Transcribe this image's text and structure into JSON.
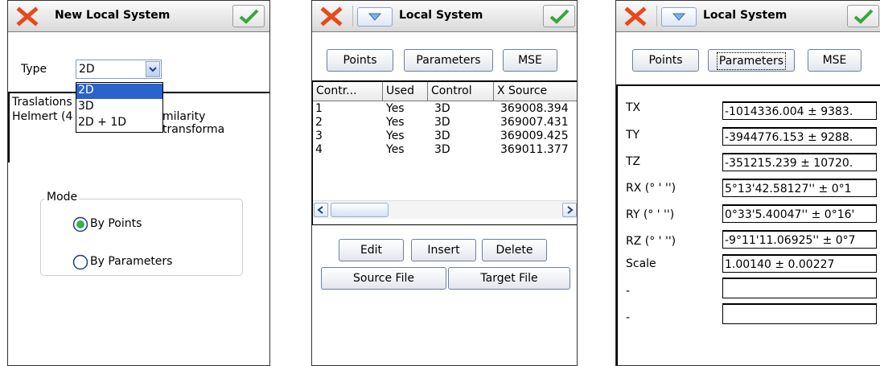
{
  "panel1": {
    "title": "New Local System",
    "type_label": "Type",
    "type_value": "2D",
    "type_options": [
      "2D",
      "3D",
      "2D + 1D"
    ],
    "description_lines": [
      "Traslations",
      "Helmert (4",
      "milarity transforma"
    ],
    "mode_legend": "Mode",
    "mode_options": [
      {
        "label": "By Points",
        "selected": true
      },
      {
        "label": "By Parameters",
        "selected": false
      }
    ]
  },
  "panel2": {
    "title": "Local System",
    "tabs": [
      "Points",
      "Parameters",
      "MSE"
    ],
    "columns": [
      "Contr...",
      "Used",
      "Control",
      "X Source"
    ],
    "rows": [
      [
        "1",
        "Yes",
        "3D",
        "369008.394"
      ],
      [
        "2",
        "Yes",
        "3D",
        "369007.431"
      ],
      [
        "3",
        "Yes",
        "3D",
        "369009.425"
      ],
      [
        "4",
        "Yes",
        "3D",
        "369011.377"
      ]
    ],
    "buttons": {
      "edit": "Edit",
      "insert": "Insert",
      "delete": "Delete",
      "source": "Source File",
      "target": "Target File"
    }
  },
  "panel3": {
    "title": "Local System",
    "tabs": [
      "Points",
      "Parameters",
      "MSE"
    ],
    "params": [
      {
        "label": "TX",
        "value": "-1014336.004 ± 9383."
      },
      {
        "label": "TY",
        "value": "-3944776.153 ± 9288."
      },
      {
        "label": "TZ",
        "value": "-351215.239 ± 10720."
      },
      {
        "label": "RX (° ' '')",
        "value": "5°13'42.58127'' ± 0°1"
      },
      {
        "label": "RY (° ' '')",
        "value": "0°33'5.40047'' ± 0°16'"
      },
      {
        "label": "RZ (° ' '')",
        "value": "-9°11'11.06925'' ± 0°7"
      },
      {
        "label": "Scale",
        "value": "1.00140 ± 0.00227"
      },
      {
        "label": "-",
        "value": ""
      },
      {
        "label": "-",
        "value": ""
      }
    ]
  },
  "colors": {
    "cancel": "#e8481c",
    "ok": "#3aa53a",
    "selection": "#2a63c9",
    "radio_on": "#37b24d"
  }
}
